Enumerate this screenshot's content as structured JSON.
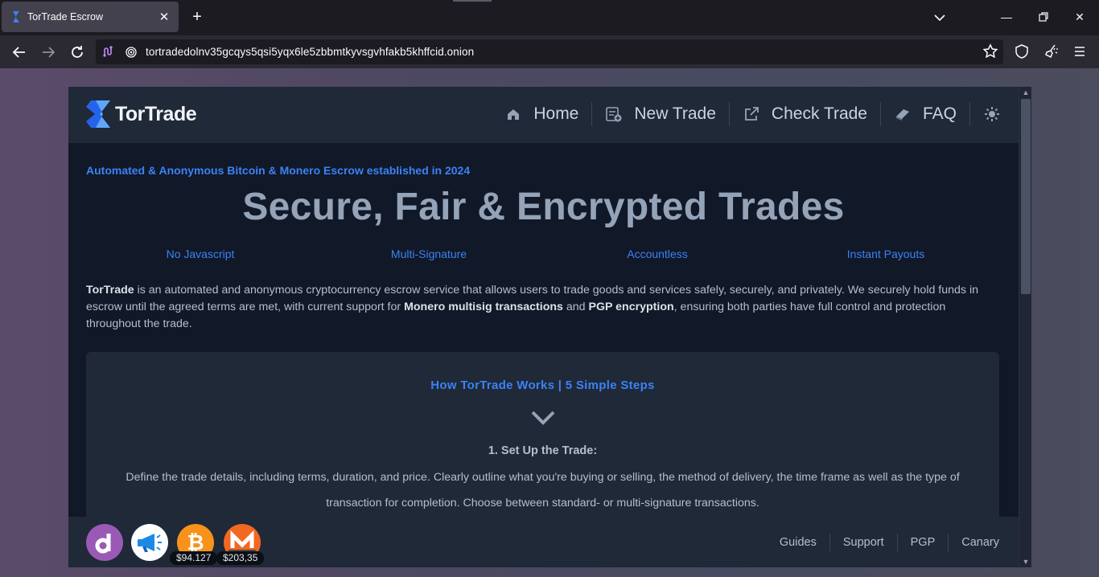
{
  "browser": {
    "tab_title": "TorTrade Escrow",
    "url": "tortradedolnv35gcqys5qsi5yqx6le5zbbmtkyvsgvhfakb5khffcid.onion"
  },
  "site": {
    "logo_text": "TorTrade",
    "nav": {
      "home": "Home",
      "new_trade": "New Trade",
      "check_trade": "Check Trade",
      "faq": "FAQ"
    },
    "tagline": "Automated & Anonymous Bitcoin & Monero Escrow established in 2024",
    "hero_title": "Secure, Fair & Encrypted Trades",
    "features": [
      "No Javascript",
      "Multi-Signature",
      "Accountless",
      "Instant Payouts"
    ],
    "intro": {
      "brand": "TorTrade",
      "part1": " is an automated and anonymous cryptocurrency escrow service that allows users to trade goods and services safely, securely, and privately. We securely hold funds in escrow until the agreed terms are met, with current support for ",
      "bold1": "Monero multisig transactions",
      "part2": " and ",
      "bold2": "PGP encryption",
      "part3": ", ensuring both parties have full control and protection throughout the trade."
    },
    "steps": {
      "title": "How TorTrade Works | 5 Simple Steps",
      "step1_title": "1. Set Up the Trade:",
      "step1_body": "Define the trade details, including terms, duration, and price. Clearly outline what you're buying or selling, the method of delivery, the time frame as well as the type of transaction for completion. Choose between standard- or multi-signature transactions."
    },
    "footer": {
      "btc_price": "$94.127",
      "xmr_price": "$203,35",
      "links": [
        "Guides",
        "Support",
        "PGP",
        "Canary"
      ]
    }
  },
  "colors": {
    "accent": "#3b82f6",
    "page_bg": "#111827",
    "card_bg": "#1f2937",
    "bitcoin": "#f7931a",
    "monero": "#f26822"
  }
}
